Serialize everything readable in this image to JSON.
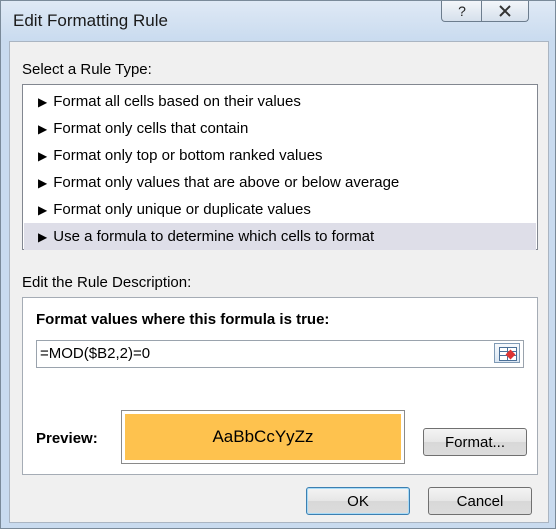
{
  "dialog": {
    "title": "Edit Formatting Rule",
    "help_label": "?",
    "close_label": "X"
  },
  "rule_type": {
    "label": "Select a Rule Type:",
    "items": [
      {
        "label": "Format all cells based on their values",
        "selected": false
      },
      {
        "label": "Format only cells that contain",
        "selected": false
      },
      {
        "label": "Format only top or bottom ranked values",
        "selected": false
      },
      {
        "label": "Format only values that are above or below average",
        "selected": false
      },
      {
        "label": "Format only unique or duplicate values",
        "selected": false
      },
      {
        "label": "Use a formula to determine which cells to format",
        "selected": true
      }
    ],
    "bullet": "▶"
  },
  "description": {
    "label": "Edit the Rule Description:",
    "formula_heading": "Format values where this formula is true:",
    "formula_value": "=MOD($B2,2)=0",
    "preview_label": "Preview:",
    "preview_text": "AaBbCcYyZz",
    "preview_fill": "#fec24e",
    "format_button": "Format..."
  },
  "buttons": {
    "ok": "OK",
    "cancel": "Cancel"
  },
  "colors": {
    "selected_row": "#dedee8",
    "title_bar": "#c9dbef"
  }
}
